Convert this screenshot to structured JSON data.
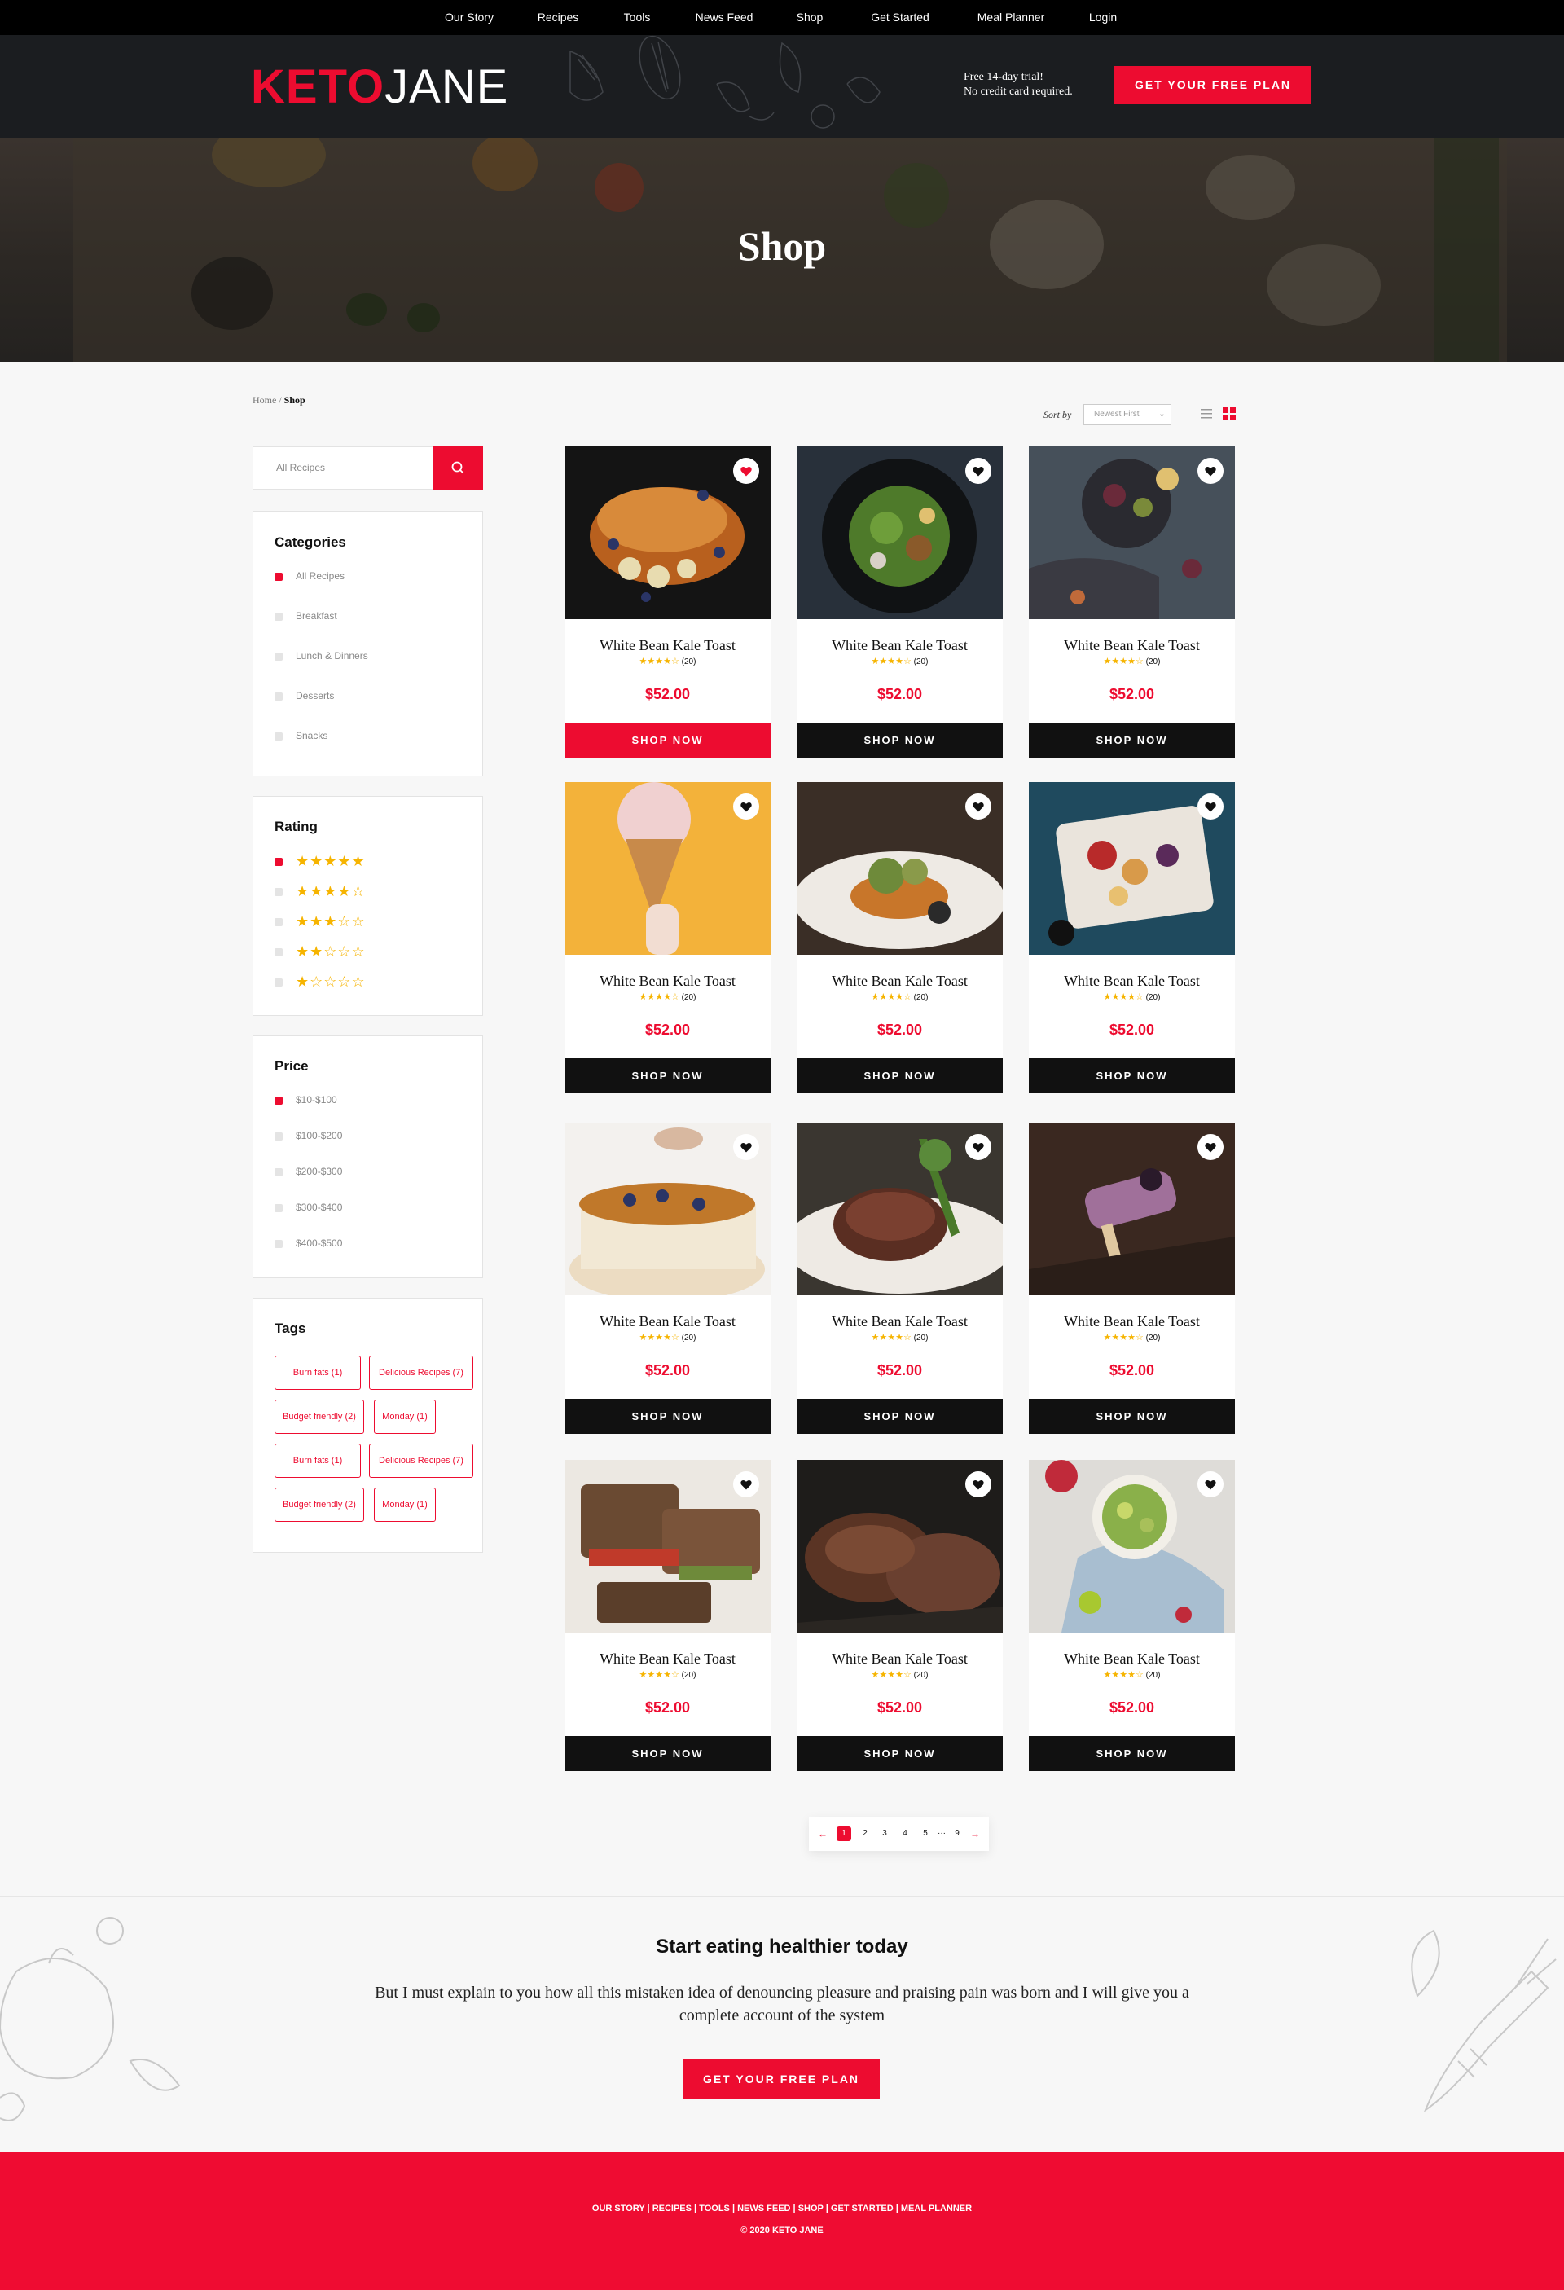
{
  "nav": {
    "items": [
      "Our Story",
      "Recipes",
      "Tools",
      "News Feed",
      "Shop",
      "Get Started",
      "Meal Planner",
      "Login"
    ],
    "active": "Shop"
  },
  "header": {
    "logo_keto": "KETO",
    "logo_jane": "JANE",
    "trial_line1": "Free 14-day trial!",
    "trial_line2": "No credit card required.",
    "cta": "GET YOUR FREE PLAN"
  },
  "hero": {
    "title": "Shop"
  },
  "breadcrumb": {
    "home": "Home",
    "separator": "/",
    "current": "Shop"
  },
  "sort": {
    "label": "Sort by",
    "selected": "Newest First"
  },
  "search": {
    "placeholder": "All Recipes"
  },
  "categories": {
    "title": "Categories",
    "items": [
      {
        "label": "All Recipes",
        "selected": true
      },
      {
        "label": "Breakfast",
        "selected": false
      },
      {
        "label": "Lunch & Dinners",
        "selected": false
      },
      {
        "label": "Desserts",
        "selected": false
      },
      {
        "label": "Snacks",
        "selected": false
      }
    ]
  },
  "rating": {
    "title": "Rating",
    "items": [
      {
        "stars": 5,
        "selected": true
      },
      {
        "stars": 4,
        "selected": false
      },
      {
        "stars": 3,
        "selected": false
      },
      {
        "stars": 2,
        "selected": false
      },
      {
        "stars": 1,
        "selected": false
      }
    ]
  },
  "price": {
    "title": "Price",
    "items": [
      {
        "label": "$10-$100",
        "selected": true
      },
      {
        "label": "$100-$200",
        "selected": false
      },
      {
        "label": "$200-$300",
        "selected": false
      },
      {
        "label": "$300-$400",
        "selected": false
      },
      {
        "label": "$400-$500",
        "selected": false
      }
    ]
  },
  "tags": {
    "title": "Tags",
    "items": [
      "Burn fats (1)",
      "Delicious Recipes (7)",
      "Budget friendly (2)",
      "Monday (1)",
      "Burn fats (1)",
      "Delicious Recipes (7)",
      "Budget friendly (2)",
      "Monday (1)"
    ]
  },
  "products": [
    {
      "title": "White Bean Kale Toast",
      "stars": 4,
      "reviews": "(20)",
      "price": "$52.00",
      "button": "SHOP NOW",
      "favorited": true,
      "highlight": true,
      "image": "french-toast-berries"
    },
    {
      "title": "White Bean Kale Toast",
      "stars": 4,
      "reviews": "(20)",
      "price": "$52.00",
      "button": "SHOP NOW",
      "favorited": false,
      "highlight": false,
      "image": "green-salad-plate"
    },
    {
      "title": "White Bean Kale Toast",
      "stars": 4,
      "reviews": "(20)",
      "price": "$52.00",
      "button": "SHOP NOW",
      "favorited": false,
      "highlight": false,
      "image": "figs-olives-platter"
    },
    {
      "title": "White Bean Kale Toast",
      "stars": 4,
      "reviews": "(20)",
      "price": "$52.00",
      "button": "SHOP NOW",
      "favorited": false,
      "highlight": false,
      "image": "ice-cream-cone"
    },
    {
      "title": "White Bean Kale Toast",
      "stars": 4,
      "reviews": "(20)",
      "price": "$52.00",
      "button": "SHOP NOW",
      "favorited": false,
      "highlight": false,
      "image": "salmon-plate"
    },
    {
      "title": "White Bean Kale Toast",
      "stars": 4,
      "reviews": "(20)",
      "price": "$52.00",
      "button": "SHOP NOW",
      "favorited": false,
      "highlight": false,
      "image": "berry-toast-tray"
    },
    {
      "title": "White Bean Kale Toast",
      "stars": 4,
      "reviews": "(20)",
      "price": "$52.00",
      "button": "SHOP NOW",
      "favorited": false,
      "highlight": false,
      "image": "blueberry-cake"
    },
    {
      "title": "White Bean Kale Toast",
      "stars": 4,
      "reviews": "(20)",
      "price": "$52.00",
      "button": "SHOP NOW",
      "favorited": false,
      "highlight": false,
      "image": "steak-broccolini"
    },
    {
      "title": "White Bean Kale Toast",
      "stars": 4,
      "reviews": "(20)",
      "price": "$52.00",
      "button": "SHOP NOW",
      "favorited": false,
      "highlight": false,
      "image": "purple-popsicle"
    },
    {
      "title": "White Bean Kale Toast",
      "stars": 4,
      "reviews": "(20)",
      "price": "$52.00",
      "button": "SHOP NOW",
      "favorited": false,
      "highlight": false,
      "image": "grilled-sandwich"
    },
    {
      "title": "White Bean Kale Toast",
      "stars": 4,
      "reviews": "(20)",
      "price": "$52.00",
      "button": "SHOP NOW",
      "favorited": false,
      "highlight": false,
      "image": "grilled-steaks"
    },
    {
      "title": "White Bean Kale Toast",
      "stars": 4,
      "reviews": "(20)",
      "price": "$52.00",
      "button": "SHOP NOW",
      "favorited": false,
      "highlight": false,
      "image": "avocado-salad-bowl"
    }
  ],
  "pagination": {
    "prev": "←",
    "pages": [
      "1",
      "2",
      "3",
      "4",
      "5",
      "···",
      "9"
    ],
    "current": "1",
    "next": "→"
  },
  "cta": {
    "title": "Start eating healthier today",
    "text": "But I must explain to you how all this mistaken idea of denouncing pleasure and praising pain was born and I will give you a complete account of the system",
    "button": "GET YOUR FREE PLAN"
  },
  "footer": {
    "links": [
      "OUR STORY",
      "RECIPES",
      "TOOLS",
      "NEWS FEED",
      "SHOP",
      "GET STARTED",
      "MEAL PLANNER"
    ],
    "separator": " | ",
    "copyright": "© 2020 KETO JANE"
  },
  "colors": {
    "accent": "#ED0C30",
    "dark": "#111111",
    "star": "#F6B400",
    "footer": "#EF0C32"
  }
}
